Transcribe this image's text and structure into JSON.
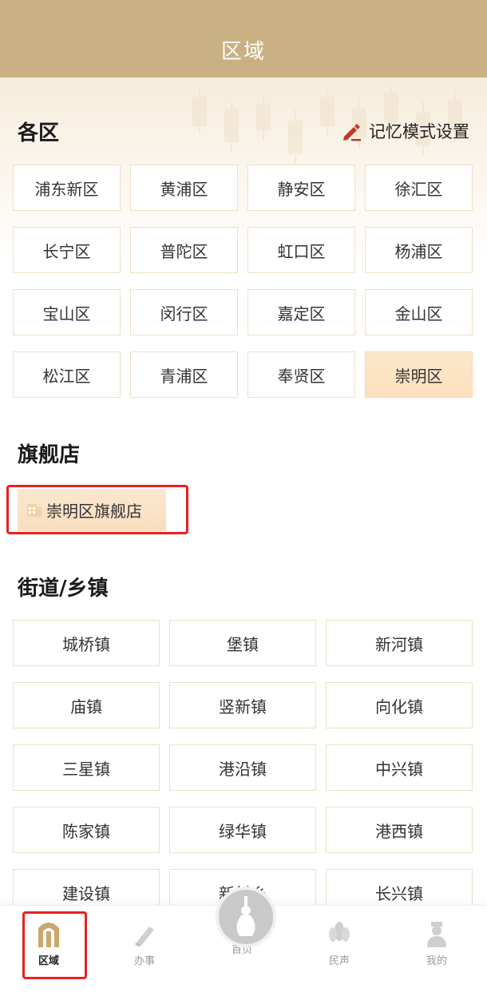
{
  "header": {
    "title": "区域"
  },
  "districts": {
    "title": "各区",
    "memory_setting": "记忆模式设置",
    "items": [
      "浦东新区",
      "黄浦区",
      "静安区",
      "徐汇区",
      "长宁区",
      "普陀区",
      "虹口区",
      "杨浦区",
      "宝山区",
      "闵行区",
      "嘉定区",
      "金山区",
      "松江区",
      "青浦区",
      "奉贤区",
      "崇明区"
    ],
    "selected": "崇明区"
  },
  "flagship": {
    "title": "旗舰店",
    "store": "崇明区旗舰店"
  },
  "streets": {
    "title": "街道/乡镇",
    "items": [
      "城桥镇",
      "堡镇",
      "新河镇",
      "庙镇",
      "竖新镇",
      "向化镇",
      "三星镇",
      "港沿镇",
      "中兴镇",
      "陈家镇",
      "绿华镇",
      "港西镇",
      "建设镇",
      "新村乡",
      "长兴镇"
    ]
  },
  "tabbar": {
    "items": [
      {
        "label": "区域",
        "icon": "region-arch-icon",
        "active": true
      },
      {
        "label": "办事",
        "icon": "pen-icon",
        "active": false
      },
      {
        "label": "首页",
        "icon": "tower-icon",
        "active": false
      },
      {
        "label": "民声",
        "icon": "flower-icon",
        "active": false
      },
      {
        "label": "我的",
        "icon": "person-icon",
        "active": false
      }
    ]
  },
  "colors": {
    "header_bg": "#c9b184",
    "selected_bg": "#fde0bd",
    "highlight_box": "#e8221f"
  }
}
